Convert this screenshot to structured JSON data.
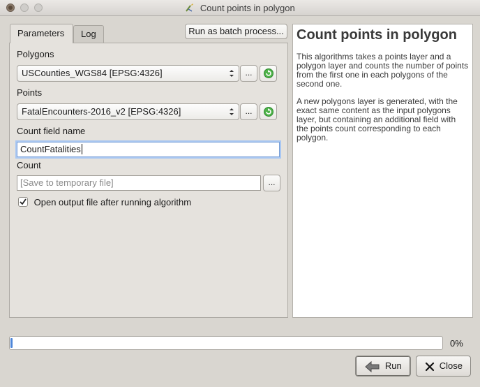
{
  "window": {
    "title": "Count points in polygon"
  },
  "tabs": [
    {
      "label": "Parameters",
      "active": true
    },
    {
      "label": "Log",
      "active": false
    }
  ],
  "batch_button": "Run as batch process...",
  "params": {
    "polygons": {
      "label": "Polygons",
      "value": "USCounties_WGS84 [EPSG:4326]",
      "more": "..."
    },
    "points": {
      "label": "Points",
      "value": "FatalEncounters-2016_v2 [EPSG:4326]",
      "more": "..."
    },
    "count_field": {
      "label": "Count field name",
      "value": "CountFatalities"
    },
    "count": {
      "label": "Count",
      "placeholder": "[Save to temporary file]",
      "more": "..."
    },
    "open_output": {
      "label": "Open output file after running algorithm",
      "checked": true
    }
  },
  "help": {
    "title": "Count points in polygon",
    "paragraphs": [
      "This algorithms takes a points layer and a polygon layer and counts the number of points from the first one in each polygons of the second one.",
      "A new polygons layer is generated, with the exact same content as the input polygons layer, but containing an additional field with the points count corresponding to each polygon."
    ]
  },
  "progress": {
    "value": 0,
    "label": "0%"
  },
  "buttons": {
    "run": "Run",
    "close": "Close"
  },
  "icons": {
    "window": "qgis-processing-icon",
    "reload": "reload-icon",
    "run": "run-arrow-icon",
    "close": "close-x-icon"
  },
  "colors": {
    "accent": "#4d86d8",
    "focus": "#a9c7f2",
    "reload_green": "#3aa33a"
  }
}
